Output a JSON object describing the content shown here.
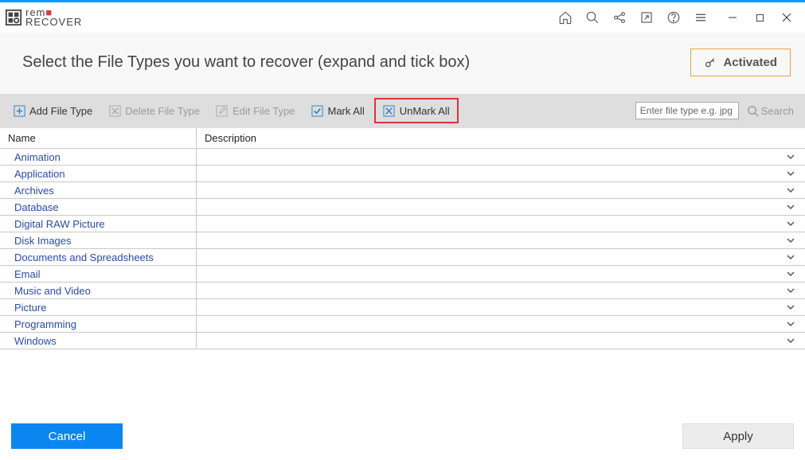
{
  "app": {
    "name1": "rem",
    "name2": "RECOVER"
  },
  "header": {
    "prompt": "Select the File Types you want to recover (expand and tick box)",
    "activated": "Activated"
  },
  "toolbar": {
    "addFileType": "Add File Type",
    "deleteFileType": "Delete File Type",
    "editFileType": "Edit File Type",
    "markAll": "Mark All",
    "unmarkAll": "UnMark All",
    "searchPlaceholder": "Enter file type e.g. jpg",
    "searchLabel": "Search"
  },
  "table": {
    "colName": "Name",
    "colDescription": "Description",
    "rows": [
      {
        "name": "Animation",
        "description": ""
      },
      {
        "name": "Application",
        "description": ""
      },
      {
        "name": "Archives",
        "description": ""
      },
      {
        "name": "Database",
        "description": ""
      },
      {
        "name": "Digital RAW Picture",
        "description": ""
      },
      {
        "name": "Disk Images",
        "description": ""
      },
      {
        "name": "Documents and Spreadsheets",
        "description": ""
      },
      {
        "name": "Email",
        "description": ""
      },
      {
        "name": "Music and Video",
        "description": ""
      },
      {
        "name": "Picture",
        "description": ""
      },
      {
        "name": "Programming",
        "description": ""
      },
      {
        "name": "Windows",
        "description": ""
      }
    ]
  },
  "footer": {
    "cancel": "Cancel",
    "apply": "Apply"
  }
}
